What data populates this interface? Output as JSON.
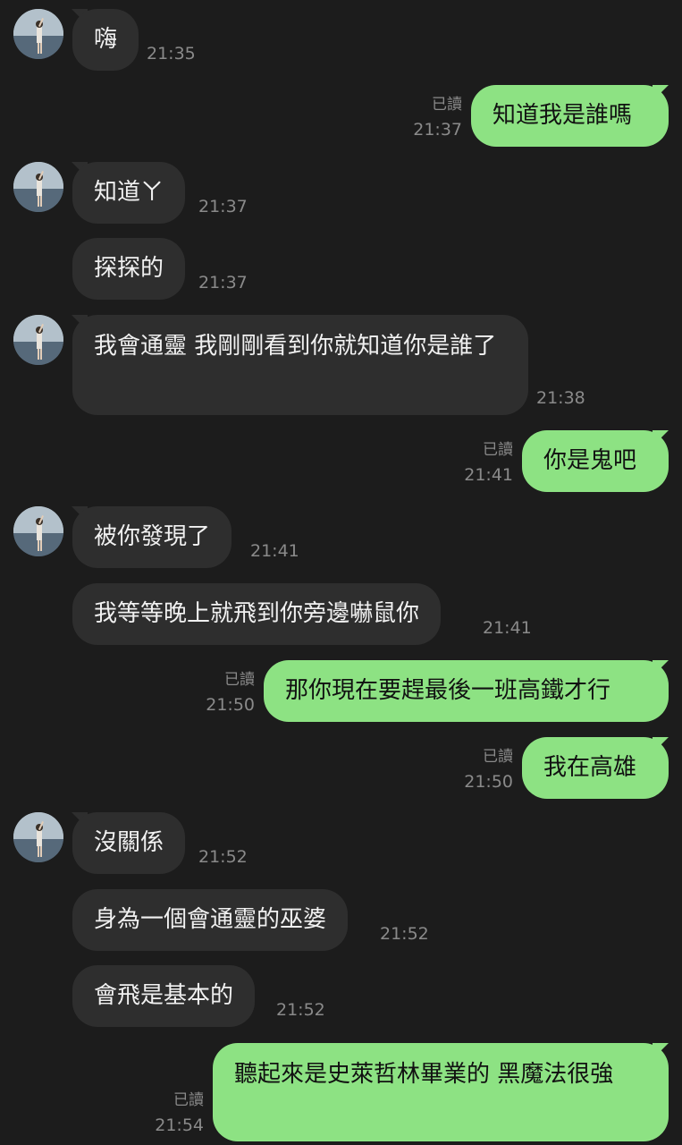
{
  "chat": {
    "read_label": "已讀",
    "messages": [
      {
        "side": "in",
        "text": "嗨",
        "time": "21:35"
      },
      {
        "side": "out",
        "text": "知道我是誰嗎",
        "time": "21:37",
        "read": "已讀"
      },
      {
        "side": "in",
        "text": "知道ㄚ",
        "time": "21:37"
      },
      {
        "side": "in",
        "text": "探探的",
        "time": "21:37"
      },
      {
        "side": "in",
        "text": "我會通靈 我剛剛看到你就知道你是誰了",
        "time": "21:38"
      },
      {
        "side": "out",
        "text": "你是鬼吧",
        "time": "21:41",
        "read": "已讀"
      },
      {
        "side": "in",
        "text": "被你發現了",
        "time": "21:41"
      },
      {
        "side": "in",
        "text": "我等等晚上就飛到你旁邊嚇鼠你",
        "time": "21:41"
      },
      {
        "side": "out",
        "text": "那你現在要趕最後一班高鐵才行",
        "time": "21:50",
        "read": "已讀"
      },
      {
        "side": "out",
        "text": "我在高雄",
        "time": "21:50",
        "read": "已讀"
      },
      {
        "side": "in",
        "text": "沒關係",
        "time": "21:52"
      },
      {
        "side": "in",
        "text": "身為一個會通靈的巫婆",
        "time": "21:52"
      },
      {
        "side": "in",
        "text": "會飛是基本的",
        "time": "21:52"
      },
      {
        "side": "out",
        "text": "聽起來是史萊哲林畢業的 黑魔法很強",
        "time": "21:54",
        "read": "已讀"
      }
    ]
  },
  "colors": {
    "background": "#1c1c1c",
    "incoming_bubble": "#2e2e2e",
    "outgoing_bubble": "#8de283",
    "timestamp": "#8a8a8a"
  },
  "icons": {
    "avatar": "profile-photo-avatar"
  }
}
